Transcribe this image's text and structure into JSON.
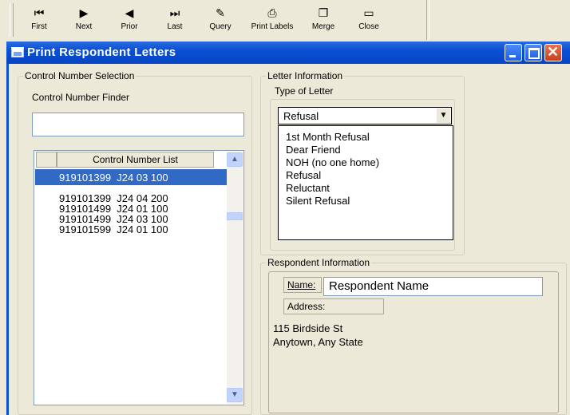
{
  "toolbar": {
    "buttons": [
      {
        "label": "First",
        "icon": "first-record-icon",
        "glyph": "⏮"
      },
      {
        "label": "Next",
        "icon": "next-record-icon",
        "glyph": "▶"
      },
      {
        "label": "Prior",
        "icon": "prior-record-icon",
        "glyph": "◀"
      },
      {
        "label": "Last",
        "icon": "last-record-icon",
        "glyph": "⏭"
      },
      {
        "label": "Query",
        "icon": "query-icon",
        "glyph": "✎"
      },
      {
        "label": "Print Labels",
        "icon": "printer-icon",
        "glyph": "⎙"
      },
      {
        "label": "Merge",
        "icon": "merge-icon",
        "glyph": "❐"
      },
      {
        "label": "Close",
        "icon": "folder-icon",
        "glyph": "▭"
      }
    ]
  },
  "window": {
    "title": "Print Respondent Letters",
    "title_color": "#0a4fd4"
  },
  "control_number_selection": {
    "legend": "Control Number Selection",
    "finder_label": "Control Number Finder",
    "finder_value": "",
    "list_header": "Control Number List",
    "items": [
      "919101399  J24 03 100",
      "919101399  J24 04 200",
      "919101499  J24 01 100",
      "919101499  J24 03 100",
      "919101599  J24 01 100"
    ],
    "selected_index": 0,
    "selection_color": "#316ac5"
  },
  "letter_information": {
    "legend": "Letter Information",
    "type_label": "Type of Letter",
    "selected_value": "Refusal",
    "options": [
      "1st Month Refusal",
      "Dear Friend",
      "NOH (no one home)",
      "Refusal",
      "Reluctant",
      "Silent Refusal"
    ]
  },
  "respondent_information": {
    "legend": "Respondent Information",
    "name_label": "Name:",
    "name_value": "Respondent Name",
    "address_label": "Address:",
    "address_line1": "115 Birdside St",
    "address_line2": "Anytown, Any State"
  }
}
